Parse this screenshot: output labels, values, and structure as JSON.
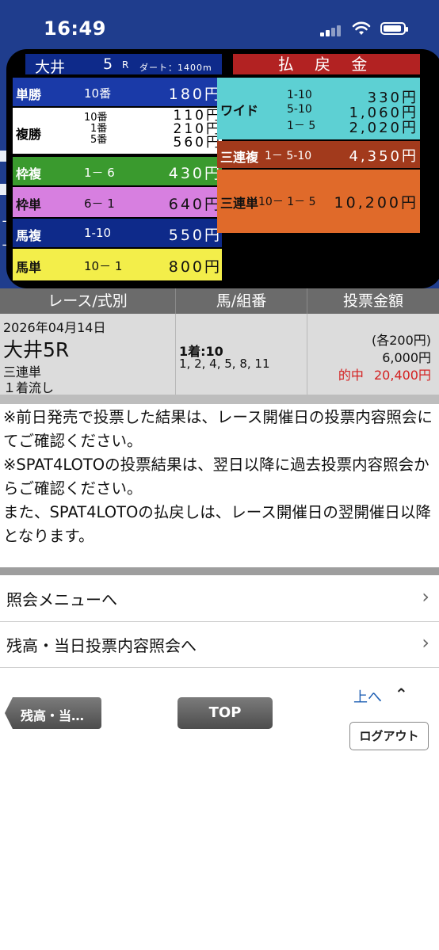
{
  "status_bar": {
    "time": "16:49"
  },
  "payout_board": {
    "venue": "大井",
    "race_number": "5",
    "race_suffix": "R",
    "distance": "ダート：1400m",
    "header": "払 戻 金",
    "tansho": {
      "label": "単勝",
      "comb": "10番",
      "amount": "180円"
    },
    "fukusho": {
      "label": "複勝",
      "combs": [
        "10番",
        "1番",
        "5番"
      ],
      "amounts": [
        "110円",
        "210円",
        "560円"
      ]
    },
    "wakufuku": {
      "label": "枠複",
      "comb": "1－ 6",
      "amount": "430円"
    },
    "wakutan": {
      "label": "枠単",
      "comb": "6－ 1",
      "amount": "640円"
    },
    "umafuku": {
      "label": "馬複",
      "comb": "1-10",
      "amount": "550円"
    },
    "umatan": {
      "label": "馬単",
      "comb": "10－ 1",
      "amount": "800円"
    },
    "wide": {
      "label": "ワイド",
      "combs": [
        "1-10",
        "5-10",
        "1－ 5"
      ],
      "amounts": [
        "330円",
        "1,060円",
        "2,020円"
      ]
    },
    "sanrenpuku": {
      "label": "三連複",
      "comb": "1－ 5-10",
      "amount": "4,350円"
    },
    "sanrentan": {
      "label": "三連単",
      "comb": "10－ 1－ 5",
      "amount": "10,200円"
    }
  },
  "table": {
    "headers": [
      "レース/式別",
      "馬/組番",
      "投票金額"
    ],
    "row": {
      "date": "2026年04月14日",
      "race": "大井5R",
      "bet_type": "三連単",
      "method": "１着流し",
      "first": "1着:10",
      "others": "1, 2, 4, 5, 8, 11",
      "each": "(各200円)",
      "total": "6,000円",
      "hit_label": "的中",
      "hit_amount": "20,400円"
    }
  },
  "notes": [
    "※前日発売で投票した結果は、レース開催日の投票内容照会にてご確認ください。",
    "※SPAT4LOTOの投票結果は、翌日以降に過去投票内容照会からご確認ください。",
    "また、SPAT4LOTOの払戻しは、レース開催日の翌開催日以降となります。"
  ],
  "menu": [
    {
      "label": "照会メニューへ"
    },
    {
      "label": "残高・当日投票内容照会へ"
    }
  ],
  "buttons": {
    "back": "残高・当…",
    "top": "TOP",
    "up": "上へ",
    "logout": "ログアウト"
  },
  "colors": {
    "header_blue": "#1f3d8d",
    "hit_red": "#d42020"
  }
}
